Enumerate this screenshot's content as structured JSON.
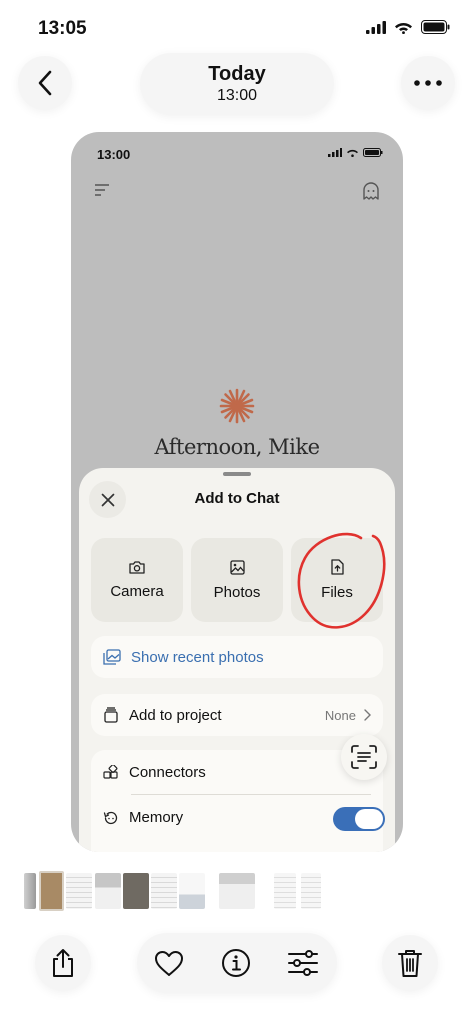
{
  "status_bar": {
    "time": "13:05"
  },
  "header": {
    "title": "Today",
    "subtitle": "13:00"
  },
  "screenshot": {
    "status_time": "13:00",
    "greeting": "Afternoon, Mike",
    "sheet": {
      "title": "Add to Chat",
      "tiles": [
        {
          "label": "Camera",
          "icon": "camera-icon"
        },
        {
          "label": "Photos",
          "icon": "image-icon"
        },
        {
          "label": "Files",
          "icon": "file-upload-icon"
        }
      ],
      "recent_photos_label": "Show recent photos",
      "project_label": "Add to project",
      "project_value": "None",
      "connectors_label": "Connectors",
      "memory_label": "Memory",
      "memory_enabled": true
    },
    "colors": {
      "accent_blue": "#3a6fb8",
      "star": "#c0694a",
      "annotation_red": "#e0322e"
    }
  },
  "toolbar": {
    "icons": [
      "share-icon",
      "heart-icon",
      "info-icon",
      "sliders-icon",
      "trash-icon"
    ]
  }
}
